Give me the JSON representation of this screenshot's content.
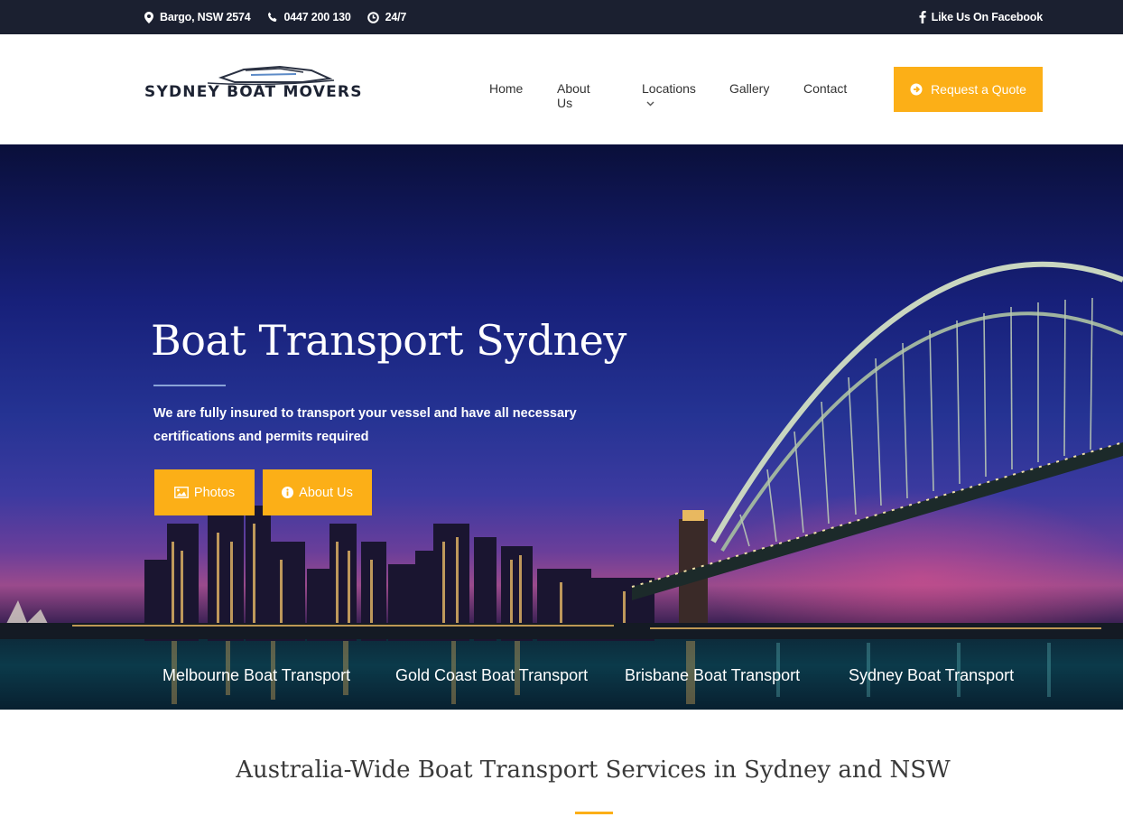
{
  "topbar": {
    "address": "Bargo, NSW 2574",
    "phone": "0447 200 130",
    "hours": "24/7",
    "facebook": "Like Us On Facebook",
    "icons": [
      "map-pin-icon",
      "phone-icon",
      "clock-icon",
      "facebook-icon"
    ]
  },
  "logo": {
    "text": "SYDNEY BOAT MOVERS"
  },
  "nav": {
    "items": [
      {
        "label": "Home"
      },
      {
        "label": "About Us"
      },
      {
        "label": "Locations"
      },
      {
        "label": "Gallery"
      },
      {
        "label": "Contact"
      }
    ],
    "quote_button": "Request a Quote"
  },
  "hero": {
    "title": "Boat Transport Sydney",
    "subtitle": "We are fully insured to transport your vessel and have all necessary certifications and permits required",
    "buttons": [
      {
        "label": "Photos",
        "icon": "image-icon"
      },
      {
        "label": "About Us",
        "icon": "info-icon"
      }
    ],
    "city_links": [
      "Melbourne Boat Transport",
      "Gold Coast Boat Transport",
      "Brisbane Boat Transport",
      "Sydney Boat Transport"
    ]
  },
  "section": {
    "title": "Australia-Wide Boat Transport Services in Sydney and NSW"
  },
  "colors": {
    "accent": "#fcaf17",
    "topbar_bg": "#1b2030",
    "text_dark": "#333333"
  }
}
